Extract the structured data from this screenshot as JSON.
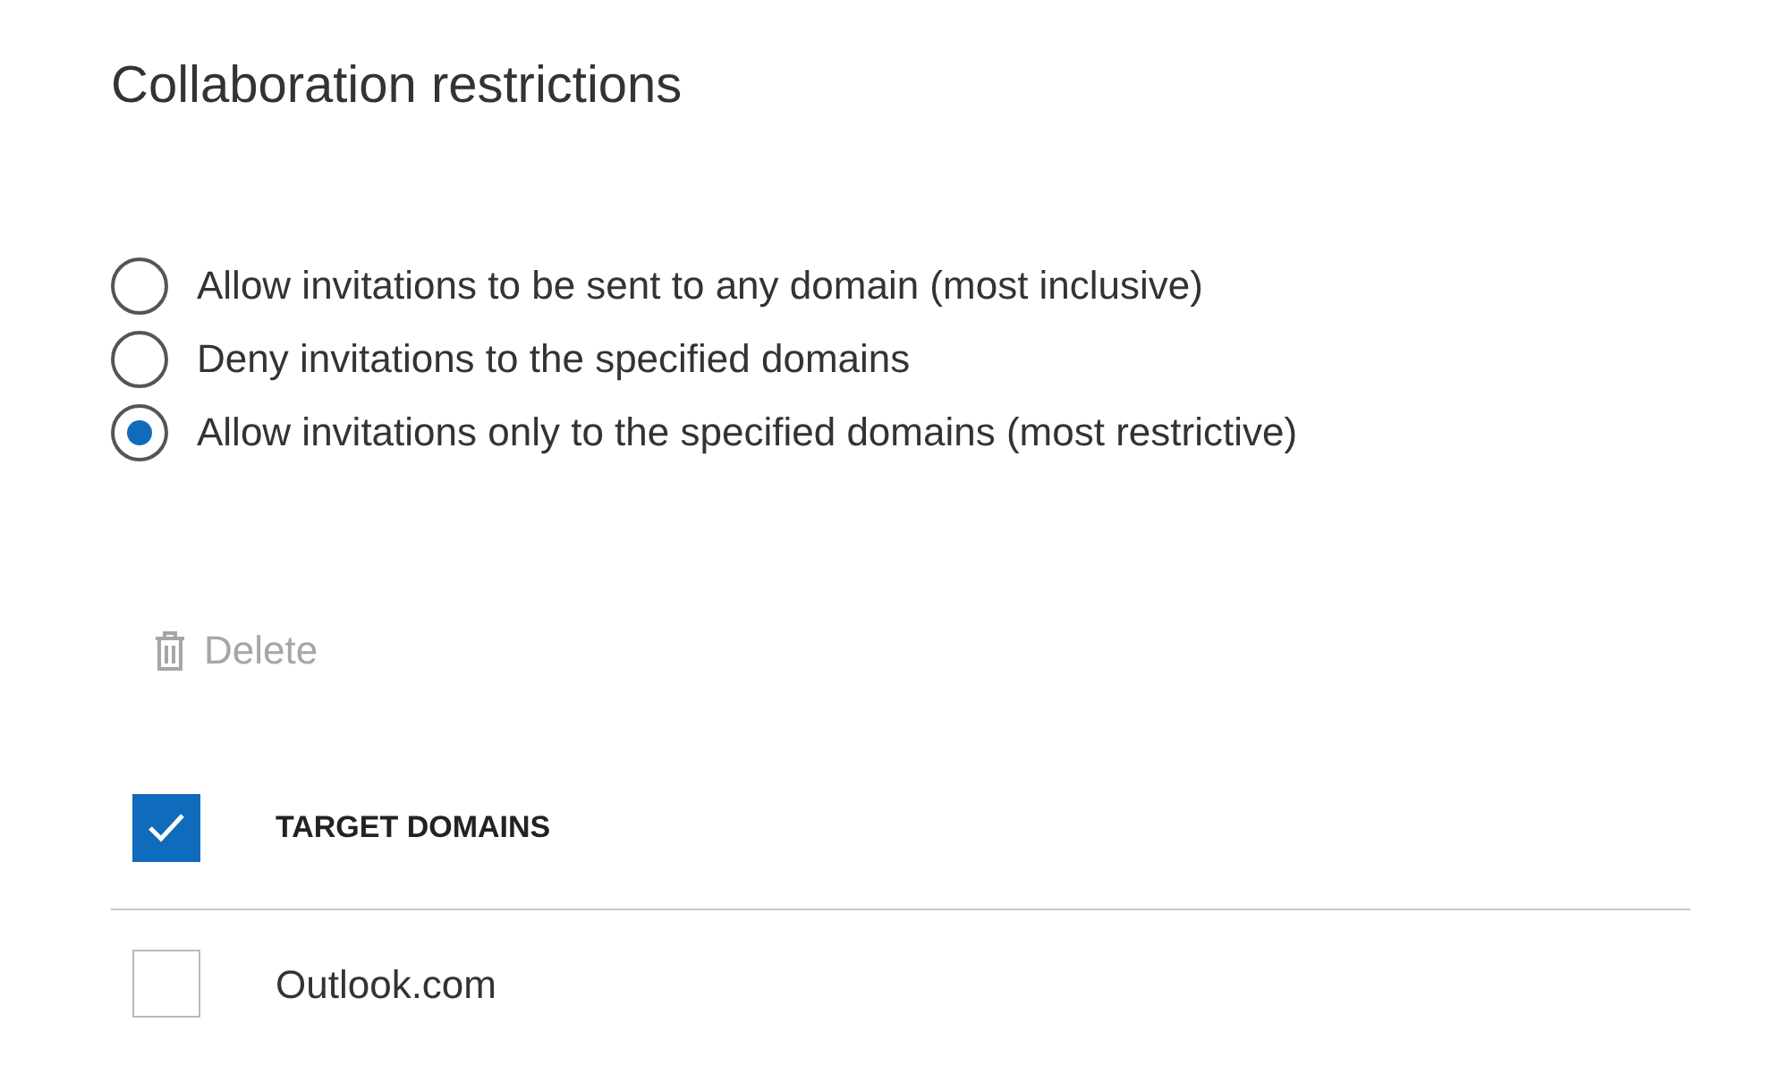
{
  "title": "Collaboration restrictions",
  "options": [
    {
      "label": "Allow invitations to be sent to any domain (most inclusive)",
      "selected": false
    },
    {
      "label": "Deny invitations to the specified domains",
      "selected": false
    },
    {
      "label": "Allow invitations only to the specified domains (most restrictive)",
      "selected": true
    }
  ],
  "delete_button": {
    "label": "Delete",
    "disabled": true
  },
  "table": {
    "header": {
      "label": "TARGET DOMAINS",
      "checked": true
    },
    "rows": [
      {
        "domain": "Outlook.com",
        "checked": false
      }
    ]
  }
}
